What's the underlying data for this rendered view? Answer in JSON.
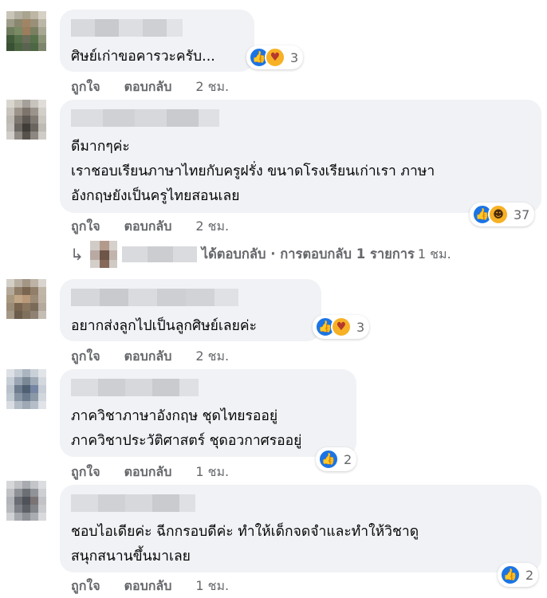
{
  "action_labels": {
    "like": "ถูกใจ",
    "reply": "ตอบกลับ"
  },
  "comments": [
    {
      "lines": [
        "ศิษย์เก่าขอคารวะครับ..."
      ],
      "reactions": [
        "like",
        "care"
      ],
      "reaction_count": "3",
      "time": "2 ชม."
    },
    {
      "lines": [
        "ดีมากๆค่ะ",
        "เราชอบเรียนภาษาไทยกับครูฝรั่ง ขนาดโรงเรียนเก่าเรา ภาษา",
        "อังกฤษยังเป็นครูไทยสอนเลย"
      ],
      "reactions": [
        "like",
        "haha"
      ],
      "reaction_count": "37",
      "time": "2 ชม."
    },
    {
      "lines": [
        "อยากส่งลูกไปเป็นลูกศิษย์เลยค่ะ"
      ],
      "reactions": [
        "like",
        "care"
      ],
      "reaction_count": "3",
      "time": "2 ชม."
    },
    {
      "lines": [
        "ภาควิชาภาษาอังกฤษ ชุดไทยรออยู่",
        "ภาควิชาประวัติศาสตร์ ชุดอวกาศรออยู่"
      ],
      "reactions": [
        "like"
      ],
      "reaction_count": "2",
      "time": "1 ชม."
    },
    {
      "lines": [
        "ชอบไอเดียค่ะ ฉีกกรอบดีค่ะ ทำให้เด็กจดจำและทำให้วิชาดู",
        "สนุกสนานขึ้นมาเลย"
      ],
      "reactions": [
        "like"
      ],
      "reaction_count": "2",
      "time": "1 ชม."
    }
  ],
  "reply_summary": {
    "text": "ได้ตอบกลับ · การตอบกลับ 1 รายการ",
    "time": "1 ชม."
  },
  "colors": {
    "bubble": "#f0f2f5",
    "like_blue": "#1b74e4",
    "secondary_text": "#65676b",
    "emoji_yellow": "#f7b125"
  },
  "icons": {
    "like": "thumbs-up-icon",
    "care": "care-hug-icon",
    "haha": "haha-laugh-icon",
    "reply_arrow": "reply-arrow-icon"
  }
}
